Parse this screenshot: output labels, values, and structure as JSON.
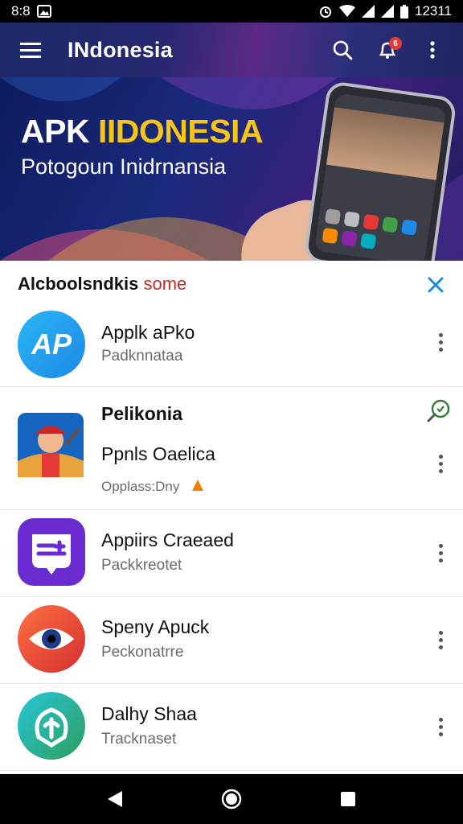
{
  "status_bar": {
    "time": "8:8",
    "clock": "12311"
  },
  "app_bar": {
    "title": "INdonesia",
    "notification_count": "6"
  },
  "banner": {
    "title_part1": "APK ",
    "title_part2": "IIDONESIA",
    "subtitle": "Potogoun Inidrnansia"
  },
  "list": {
    "title": "Alcboolsndkis",
    "title_accent": "some",
    "items": [
      {
        "name": "Applk aPko",
        "sub": "Padknnataa",
        "icon": "ap-logo-icon",
        "icon_text": "AP",
        "colors": [
          "#1e88e5",
          "#29b6f6"
        ]
      },
      {
        "name": "Pelikonia",
        "line2": "Ppnls Oaelica",
        "sub": "Opplass:Dny",
        "icon": "character-avatar-icon",
        "colors": [
          "#1565c0",
          "#e57373"
        ]
      },
      {
        "name": "Appiirs Craeaed",
        "sub": "Packkreotet",
        "icon": "purple-app-icon",
        "colors": [
          "#5e35b1",
          "#7e57c2"
        ]
      },
      {
        "name": "Speny Apuck",
        "sub": "Peckonatrre",
        "icon": "eye-app-icon",
        "colors": [
          "#e53935",
          "#ff7043"
        ]
      },
      {
        "name": "Dalhy Shaa",
        "sub": "Tracknaset",
        "icon": "signal-app-icon",
        "colors": [
          "#26c6da",
          "#43a047"
        ]
      }
    ]
  },
  "colors": {
    "accent_yellow": "#f5c518",
    "close_blue": "#1e88e5",
    "title_accent_red": "#c62828"
  }
}
